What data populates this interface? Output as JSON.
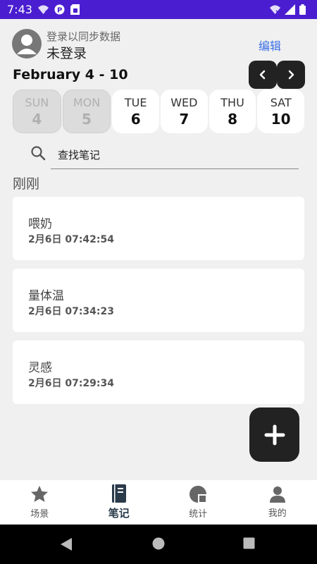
{
  "status_bar": {
    "time": "7:43",
    "icons": [
      "wifi-question-icon",
      "p-icon",
      "sim-icon",
      "wifi-off-icon",
      "signal-icon",
      "battery-icon"
    ]
  },
  "header": {
    "login_sub": "登录以同步数据",
    "login_main": "未登录",
    "edit_label": "编辑"
  },
  "week": {
    "title": "February 4 - 10",
    "days": [
      {
        "name": "SUN",
        "num": "4",
        "disabled": true
      },
      {
        "name": "MON",
        "num": "5",
        "disabled": true
      },
      {
        "name": "TUE",
        "num": "6",
        "disabled": false
      },
      {
        "name": "WED",
        "num": "7",
        "disabled": false
      },
      {
        "name": "THU",
        "num": "8",
        "disabled": false
      },
      {
        "name": "SAT",
        "num": "10",
        "disabled": false
      }
    ]
  },
  "search": {
    "placeholder": "查找笔记"
  },
  "section": {
    "title": "刚刚"
  },
  "notes": [
    {
      "title": "喂奶",
      "time": "2月6日 07:42:54"
    },
    {
      "title": "量体温",
      "time": "2月6日 07:34:23"
    },
    {
      "title": "灵感",
      "time": "2月6日 07:29:34"
    }
  ],
  "bottom_nav": {
    "tabs": [
      {
        "label": "场景",
        "icon": "star-icon"
      },
      {
        "label": "笔记",
        "icon": "notebook-icon"
      },
      {
        "label": "统计",
        "icon": "pie-chart-icon"
      },
      {
        "label": "我的",
        "icon": "person-icon"
      }
    ],
    "active_index": 1
  },
  "colors": {
    "status_bar": "#4a1ed0",
    "accent": "#3b6fe6",
    "dark": "#222222",
    "background": "#f0f0f0"
  }
}
